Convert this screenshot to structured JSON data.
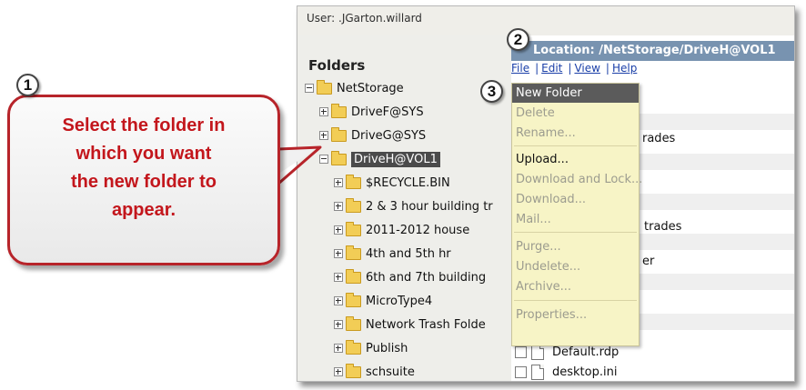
{
  "user": {
    "label": "User: .JGarton.willard"
  },
  "location": {
    "label": "Location: /NetStorage/DriveH@VOL1"
  },
  "menu": {
    "file": "File",
    "edit": "Edit",
    "view": "View",
    "help": "Help",
    "sep": "|"
  },
  "folders": {
    "header": "Folders",
    "root": "NetStorage",
    "drives": [
      "DriveF@SYS",
      "DriveG@SYS",
      "DriveH@VOL1"
    ],
    "children": [
      "$RECYCLE.BIN",
      "2 & 3 hour building tr",
      "2011-2012 house",
      "4th and 5th hr",
      "6th and 7th building",
      "MicroType4",
      "Network Trash Folde",
      "Publish",
      "schsuite"
    ]
  },
  "context_menu": {
    "items": [
      "New Folder",
      "Delete",
      "Rename...",
      "Upload...",
      "Download and Lock...",
      "Download...",
      "Mail...",
      "Purge...",
      "Undelete...",
      "Archive...",
      "Properties..."
    ],
    "highlighted_index": 0,
    "enabled_indices": [
      0,
      3
    ]
  },
  "list_fragments": [
    "rades",
    "trades",
    "er"
  ],
  "files": [
    "Default.rdp",
    "desktop.ini"
  ],
  "callout": {
    "lines": [
      "Select the folder in",
      "which you want",
      "the new folder to",
      "appear."
    ]
  },
  "badges": {
    "one": "1",
    "two": "2",
    "three": "3"
  },
  "colors": {
    "callout_text": "#c3161c",
    "callout_border": "#b7242a",
    "location_bar": "#7893b0",
    "menu_bg": "#f7f4c6",
    "selected": "#4b4b4b",
    "link": "#1a3fa8"
  }
}
